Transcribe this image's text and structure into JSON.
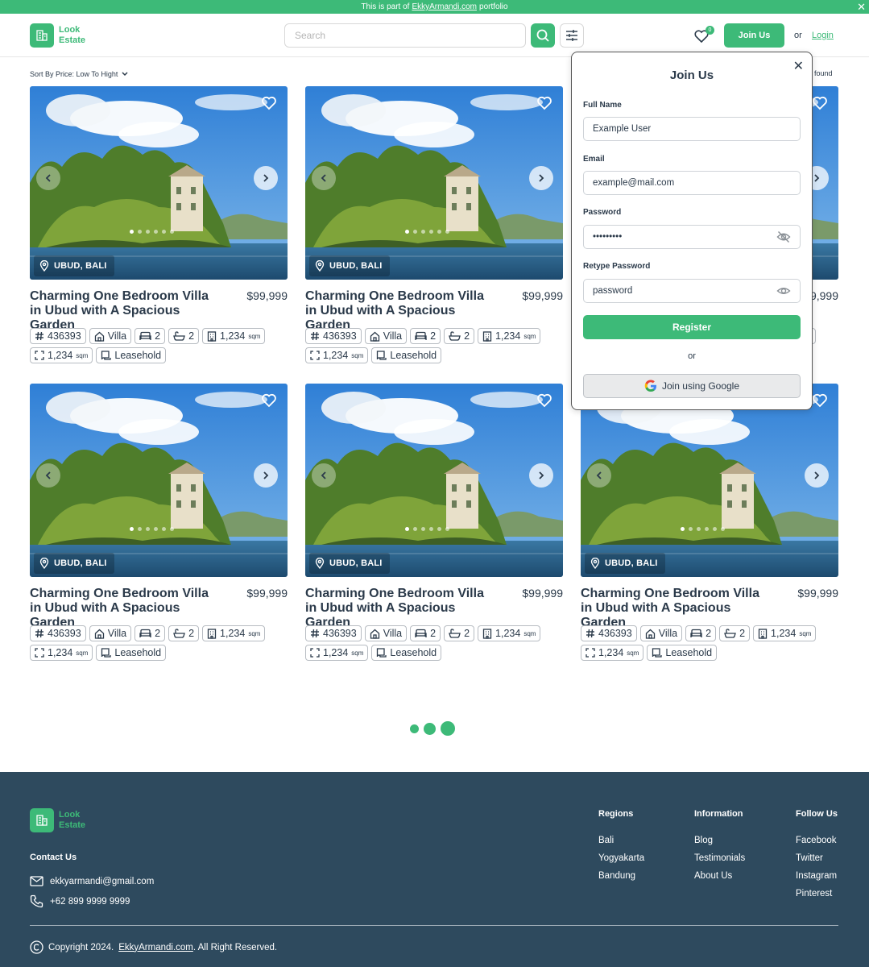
{
  "banner": {
    "prefix": "This is part of",
    "link": "EkkyArmandi.com",
    "suffix": "portfolio",
    "close": "✕"
  },
  "brand": {
    "line1": "Look",
    "line2": "Estate",
    "accent": "#3dba78"
  },
  "header": {
    "search_placeholder": "Search",
    "favorites_count": "0",
    "join_label": "Join Us",
    "or_label": "or",
    "login_label": "Login"
  },
  "sort": {
    "label": "Sort By Price: Low To Hight",
    "found_text": "s found"
  },
  "card": {
    "location": "UBUD, BALI",
    "title": "Charming One Bedroom Villa in Ubud with A Spacious Garden",
    "price": "$99,999",
    "id": "436393",
    "type": "Villa",
    "beds": "2",
    "baths": "2",
    "building_area": "1,234",
    "land_area": "1,234",
    "unit": "sqm",
    "tenure": "Leasehold"
  },
  "modal": {
    "title": "Join Us",
    "close": "✕",
    "full_name_label": "Full Name",
    "full_name_value": "Example User",
    "email_label": "Email",
    "email_value": "example@mail.com",
    "password_label": "Password",
    "password_value": "•••••••••",
    "retype_label": "Retype Password",
    "retype_value": "password",
    "register_label": "Register",
    "or_label": "or",
    "google_label": "Join using Google"
  },
  "footer": {
    "contact_heading": "Contact Us",
    "email": "ekkyarmandi@gmail.com",
    "phone": "+62 899 9999 9999",
    "regions": {
      "heading": "Regions",
      "items": [
        "Bali",
        "Yogyakarta",
        "Bandung"
      ]
    },
    "information": {
      "heading": "Information",
      "items": [
        "Blog",
        "Testimonials",
        "About Us"
      ]
    },
    "follow": {
      "heading": "Follow Us",
      "items": [
        "Facebook",
        "Twitter",
        "Instagram",
        "Pinterest"
      ]
    },
    "copyright_prefix": "Copyright 2024.",
    "copyright_link": "EkkyArmandi.com",
    "copyright_suffix": ". All Right Reserved."
  }
}
